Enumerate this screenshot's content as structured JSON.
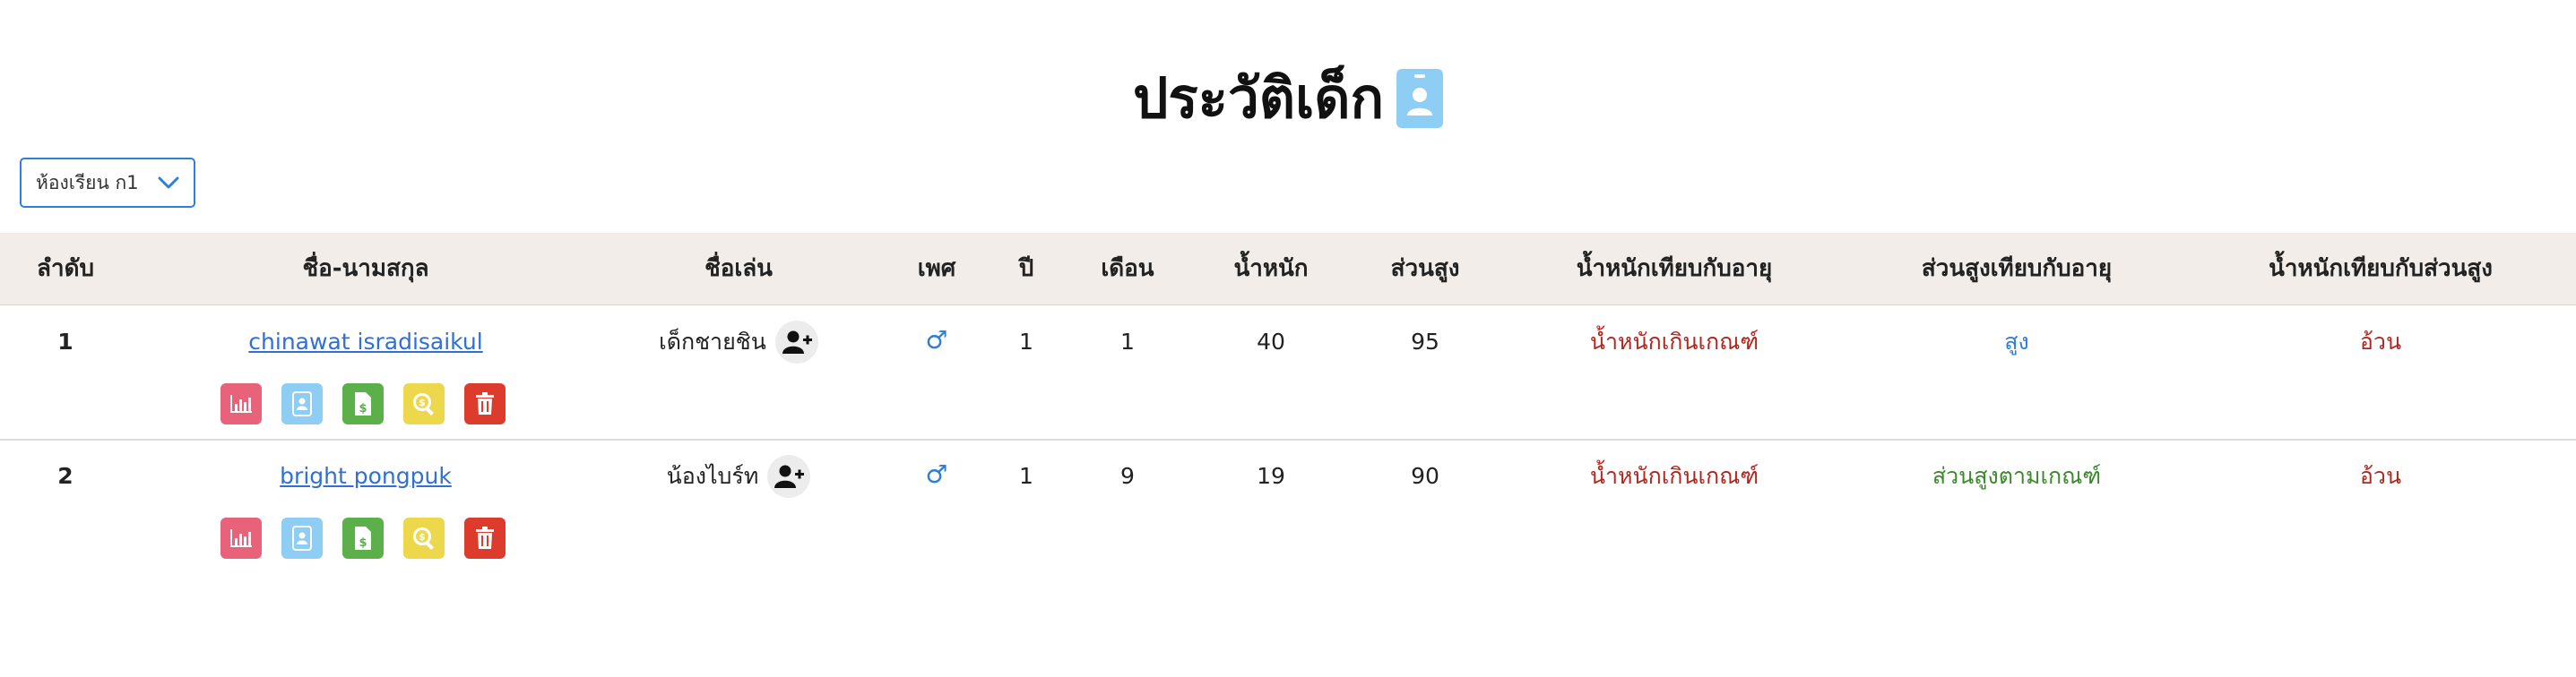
{
  "header": {
    "title": "ประวัติเด็ก",
    "title_icon": "id-badge-icon"
  },
  "class_select": {
    "value": "ห้องเรียน ก1"
  },
  "table": {
    "columns": [
      "ลำดับ",
      "ชื่อ-นามสกุล",
      "ชื่อเล่น",
      "เพศ",
      "ปี",
      "เดือน",
      "น้ำหนัก",
      "ส่วนสูง",
      "น้ำหนักเทียบกับอายุ",
      "ส่วนสูงเทียบกับอายุ",
      "น้ำหนักเทียบกับส่วนสูง"
    ],
    "rows": [
      {
        "index": "1",
        "name": "chinawat isradisaikul",
        "nickname": "เด็กชายชิน",
        "gender": "♂",
        "years": "1",
        "months": "1",
        "weight": "40",
        "height": "95",
        "weight_for_age": "น้ำหนักเกินเกณฑ์",
        "height_for_age": "สูง",
        "weight_for_height": "อ้วน"
      },
      {
        "index": "2",
        "name": "bright pongpuk",
        "nickname": "น้องไบร์ท",
        "gender": "♂",
        "years": "1",
        "months": "9",
        "weight": "19",
        "height": "90",
        "weight_for_age": "น้ำหนักเกินเกณฑ์",
        "height_for_age": "ส่วนสูงตามเกณฑ์",
        "weight_for_height": "อ้วน"
      }
    ]
  },
  "colors": {
    "link": "#2f6fd6",
    "status_over": "#b3261e",
    "status_tall": "#2f7fd8",
    "status_normal": "#3a8a2a",
    "header_bg": "#f2ede8"
  }
}
